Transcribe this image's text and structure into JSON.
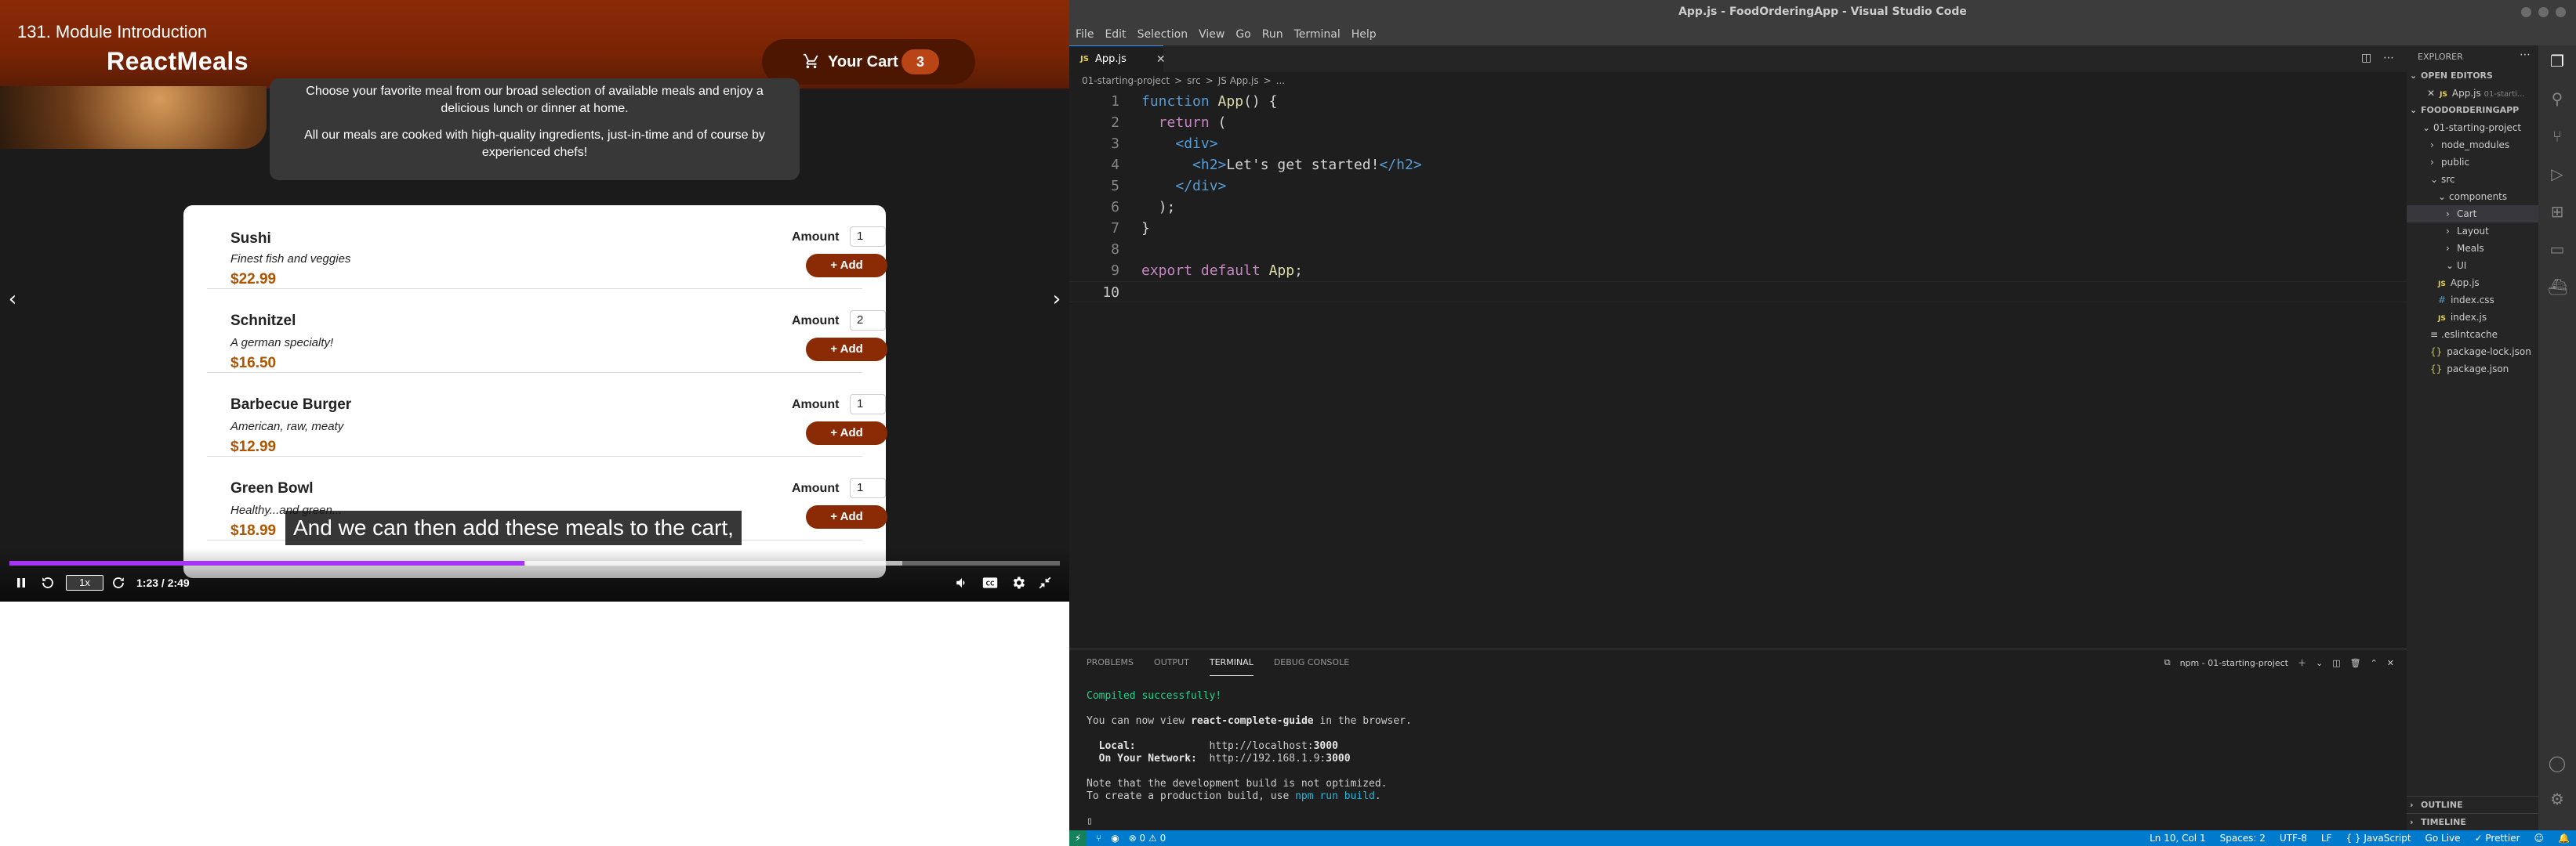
{
  "player": {
    "video_title": "131. Module Introduction",
    "caption": "And we can then add these meals to the cart,",
    "rate": "1x",
    "time": "1:23 / 2:49",
    "progress_fraction": 0.49,
    "buffer_fraction": 0.85,
    "colors": {
      "progress": "#a435f0"
    }
  },
  "app": {
    "title": "ReactMeals",
    "cart_label": "Your Cart",
    "cart_count": "3",
    "summary_line1": "Choose your favorite meal from our broad selection of available meals and enjoy a delicious lunch or dinner at home.",
    "summary_line2": "All our meals are cooked with high-quality ingredients, just-in-time and of course by experienced chefs!",
    "amount_label": "Amount",
    "add_label": "+ Add",
    "meals": [
      {
        "name": "Sushi",
        "description": "Finest fish and veggies",
        "price": "$22.99",
        "amount": "1"
      },
      {
        "name": "Schnitzel",
        "description": "A german specialty!",
        "price": "$16.50",
        "amount": "2"
      },
      {
        "name": "Barbecue Burger",
        "description": "American, raw, meaty",
        "price": "$12.99",
        "amount": "1"
      },
      {
        "name": "Green Bowl",
        "description": "Healthy...and green...",
        "price": "$18.99",
        "amount": "1"
      }
    ]
  },
  "vscode": {
    "window_title": "App.js - FoodOrderingApp - Visual Studio Code",
    "menu": [
      "File",
      "Edit",
      "Selection",
      "View",
      "Go",
      "Run",
      "Terminal",
      "Help"
    ],
    "tab_label": "App.js",
    "breadcrumb": [
      "01-starting-project",
      ">",
      "src",
      ">",
      "JS App.js",
      ">",
      "..."
    ],
    "code_lines": [
      {
        "n": "1"
      },
      {
        "n": "2"
      },
      {
        "n": "3"
      },
      {
        "n": "4"
      },
      {
        "n": "5"
      },
      {
        "n": "6"
      },
      {
        "n": "7"
      },
      {
        "n": "8"
      },
      {
        "n": "9"
      },
      {
        "n": "10"
      }
    ],
    "code": {
      "l1_kw": "function",
      "l1_fn": "App",
      "l1_rest": "() {",
      "l2_kw": "return",
      "l2_rest": " (",
      "l3": "<div>",
      "l4_open": "<h2>",
      "l4_text": "Let's get started!",
      "l4_close": "</h2>",
      "l5": "</div>",
      "l6": ");",
      "l7": "}",
      "l9_kw1": "export",
      "l9_kw2": "default",
      "l9_id": "App",
      "l9_end": ";"
    },
    "panel_tabs": [
      "PROBLEMS",
      "OUTPUT",
      "TERMINAL",
      "DEBUG CONSOLE"
    ],
    "terminal_name": "npm - 01-starting-project",
    "terminal": {
      "compiled": "Compiled successfully!",
      "view_pre": "You can now view ",
      "view_app": "react-complete-guide",
      "view_post": " in the browser.",
      "local_label": "  Local:",
      "local_pre": "            http://localhost:",
      "local_port": "3000",
      "network_label": "  On Your Network:",
      "network_pre": "  http://192.168.1.9:",
      "network_port": "3000",
      "note1": "Note that the development build is not optimized.",
      "note2_pre": "To create a production build, use ",
      "note2_cmd": "npm run build",
      "note2_post": "."
    },
    "explorer": {
      "title": "EXPLORER",
      "open_editors": "OPEN EDITORS",
      "open_file": "App.js",
      "open_file_path": "01-starti...",
      "project": "FOODORDERINGAPP",
      "tree": [
        {
          "label": "01-starting-project",
          "kind": "folder-open",
          "indent": 1
        },
        {
          "label": "node_modules",
          "kind": "folder",
          "indent": 2
        },
        {
          "label": "public",
          "kind": "folder",
          "indent": 2
        },
        {
          "label": "src",
          "kind": "folder-open",
          "indent": 2
        },
        {
          "label": "components",
          "kind": "folder-open",
          "indent": 3
        },
        {
          "label": "Cart",
          "kind": "folder",
          "indent": 4,
          "selected": true
        },
        {
          "label": "Layout",
          "kind": "folder",
          "indent": 4
        },
        {
          "label": "Meals",
          "kind": "folder",
          "indent": 4
        },
        {
          "label": "UI",
          "kind": "folder-open",
          "indent": 4
        },
        {
          "label": "App.js",
          "kind": "js",
          "indent": 3
        },
        {
          "label": "index.css",
          "kind": "css",
          "indent": 3
        },
        {
          "label": "index.js",
          "kind": "js",
          "indent": 3
        },
        {
          "label": ".eslintcache",
          "kind": "file",
          "indent": 2
        },
        {
          "label": "package-lock.json",
          "kind": "json",
          "indent": 2
        },
        {
          "label": "package.json",
          "kind": "json",
          "indent": 2
        }
      ],
      "outline": "OUTLINE",
      "timeline": "TIMELINE"
    },
    "status": {
      "problems": "⊗ 0 ⚠ 0",
      "position": "Ln 10, Col 1",
      "spaces": "Spaces: 2",
      "encoding": "UTF-8",
      "eol": "LF",
      "language": "{ } JavaScript",
      "golive": "Go Live",
      "prettier": "✓ Prettier"
    },
    "colors": {
      "accent": "#007acc",
      "keyword": "#c586c0",
      "tag": "#569cd6",
      "function": "#dcdcaa"
    }
  }
}
